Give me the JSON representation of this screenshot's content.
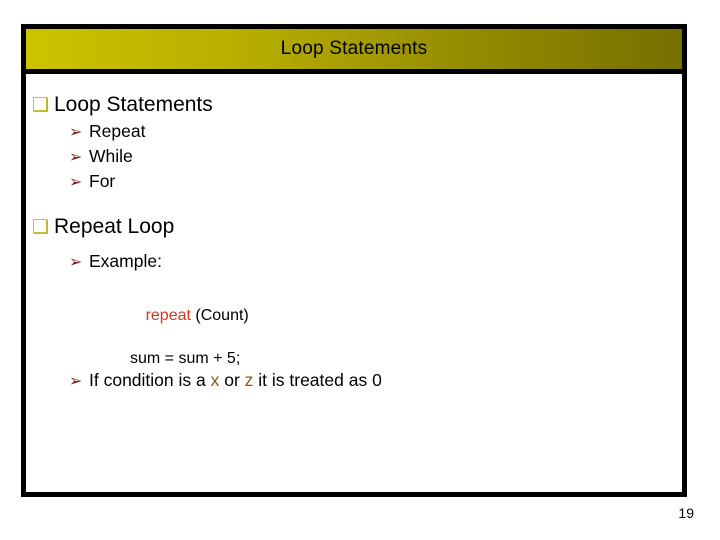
{
  "slide": {
    "title": "Loop Statements",
    "page_number": "19",
    "colors": {
      "title_gradient_start": "#cdc400",
      "title_gradient_end": "#767000",
      "frame_border": "#000000",
      "square_bullet": "#b8b000",
      "arrow_bullet": "#76231f",
      "keyword": "#cc3a22",
      "variable": "#8b5a1a"
    },
    "bullets": {
      "square_glyph": "❑",
      "arrow_glyph": "➢"
    },
    "sections": [
      {
        "heading": "Loop Statements",
        "items": [
          "Repeat",
          "While",
          "For"
        ]
      },
      {
        "heading": "Repeat Loop",
        "items": [
          "Example:"
        ]
      }
    ],
    "code": {
      "line1_keyword": "repeat",
      "line1_rest": " (Count)",
      "line2": "sum = sum + 5;"
    },
    "note": {
      "part1": "If condition is a ",
      "var1": "x",
      "part2": " or ",
      "var2": "z",
      "part3": " it is treated as 0"
    }
  }
}
